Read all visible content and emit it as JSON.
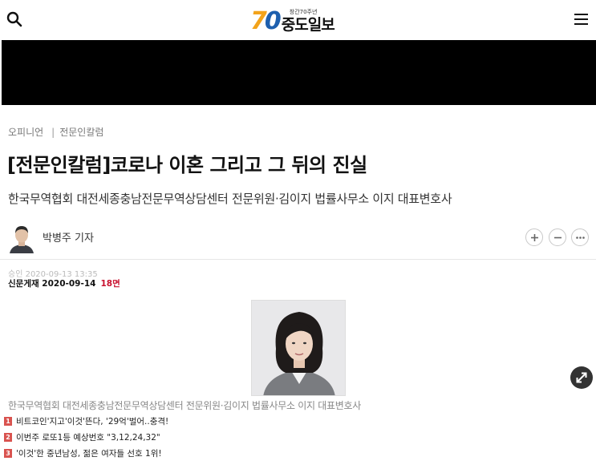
{
  "header": {
    "logo_number": "70",
    "logo_sub": "창간70주년",
    "logo_name": "중도일보"
  },
  "breadcrumb": {
    "section": "오피니언",
    "subsection": "전문인칼럼"
  },
  "article": {
    "title": "[전문인칼럼]코로나 이혼 그리고 그 뒤의 진실",
    "subtitle": "한국무역협회 대전세종충남전문무역상담센터 전문위원·김이지 법률사무소 이지 대표변호사",
    "author": "박병주 기자",
    "approved": "승인 2020-09-13 13:35",
    "paper_label": "신문게재 2020-09-14",
    "paper_page": "18면",
    "photo_caption": "한국무역협회 대전세종충남전문무역상담센터 전문위원·김이지 법률사무소 이지 대표변호사"
  },
  "news_list": [
    {
      "rank": "1",
      "text": "비트코인'지고'이것'뜬다, '29억'벌어..충격!"
    },
    {
      "rank": "2",
      "text": "이번주 로또1등 예상번호 \"3,12,24,32\""
    },
    {
      "rank": "3",
      "text": "'이것'한 중년남성, 젊은 여자들 선호 1위!"
    }
  ],
  "icons": {
    "search": "search-icon",
    "menu": "hamburger-menu-icon",
    "font_increase": "plus-icon",
    "font_decrease": "minus-icon",
    "more": "more-icon",
    "expand": "expand-icon"
  },
  "colors": {
    "logo_seven": "#f2a31b",
    "logo_zero": "#1d5fae",
    "rank_badge": "#d9534f",
    "paper_page": "#c8102e"
  }
}
